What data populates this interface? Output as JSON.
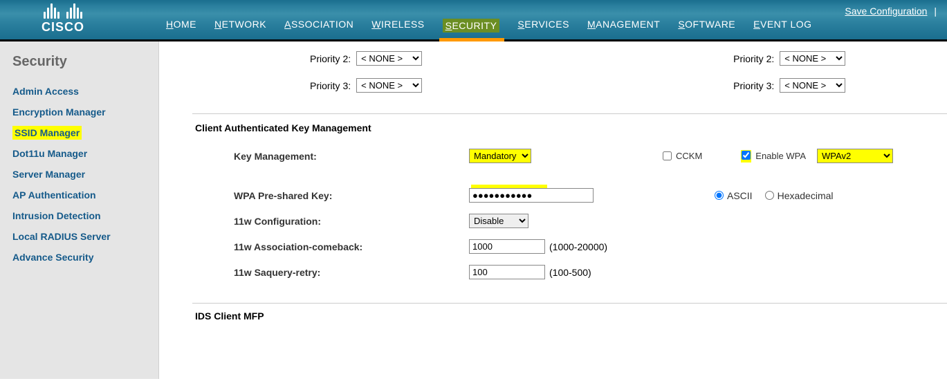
{
  "header": {
    "brand": "CISCO",
    "save": "Save Configuration",
    "nav": [
      "HOME",
      "NETWORK",
      "ASSOCIATION",
      "WIRELESS",
      "SECURITY",
      "SERVICES",
      "MANAGEMENT",
      "SOFTWARE",
      "EVENT LOG"
    ]
  },
  "sidebar": {
    "title": "Security",
    "items": [
      "Admin Access",
      "Encryption Manager",
      "SSID Manager",
      "Dot11u Manager",
      "Server Manager",
      "AP Authentication",
      "Intrusion Detection",
      "Local RADIUS Server",
      "Advance Security"
    ]
  },
  "priority": {
    "left": {
      "p2_label": "Priority 2:",
      "p2_value": "< NONE >",
      "p3_label": "Priority 3:",
      "p3_value": "< NONE >"
    },
    "right": {
      "p2_label": "Priority 2:",
      "p2_value": "< NONE >",
      "p3_label": "Priority 3:",
      "p3_value": "< NONE >"
    }
  },
  "cakm": {
    "title": "Client Authenticated Key Management",
    "key_mgmt_label": "Key Management:",
    "key_mgmt_value": "Mandatory",
    "cckm_label": "CCKM",
    "enable_wpa_label": "Enable WPA",
    "wpa_version": "WPAv2",
    "psk_label": "WPA Pre-shared Key:",
    "psk_value": "●●●●●●●●●●●",
    "ascii_label": "ASCII",
    "hex_label": "Hexadecimal",
    "w11_cfg_label": "11w Configuration:",
    "w11_cfg_value": "Disable",
    "w11_assoc_label": "11w Association-comeback:",
    "w11_assoc_value": "1000",
    "w11_assoc_hint": "(1000-20000)",
    "w11_saq_label": "11w Saquery-retry:",
    "w11_saq_value": "100",
    "w11_saq_hint": "(100-500)"
  },
  "next_section": "IDS Client MFP"
}
